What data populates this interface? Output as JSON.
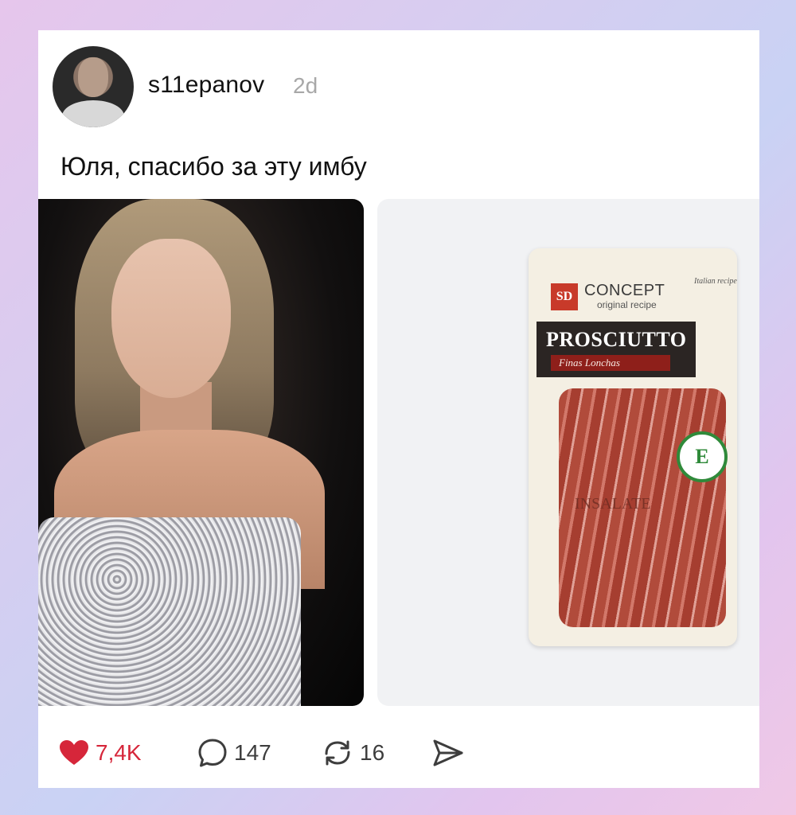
{
  "post": {
    "username": "s11epanov",
    "age": "2d",
    "text": "Юля, спасибо за эту имбу"
  },
  "media": {
    "right_image": {
      "brand": "CONCEPT",
      "recipe": "original recipe",
      "origin_mark": "Italian recipe",
      "product_name": "PROSCIUTTO",
      "subname": "Finas Lonchas",
      "overlay_text": "INSALATE",
      "badge": "E",
      "logo_text": "SD"
    }
  },
  "actions": {
    "likes": "7,4K",
    "comments": "147",
    "reposts": "16"
  },
  "colors": {
    "like": "#d6263a",
    "text": "#111111",
    "muted": "#a8a8a8"
  }
}
